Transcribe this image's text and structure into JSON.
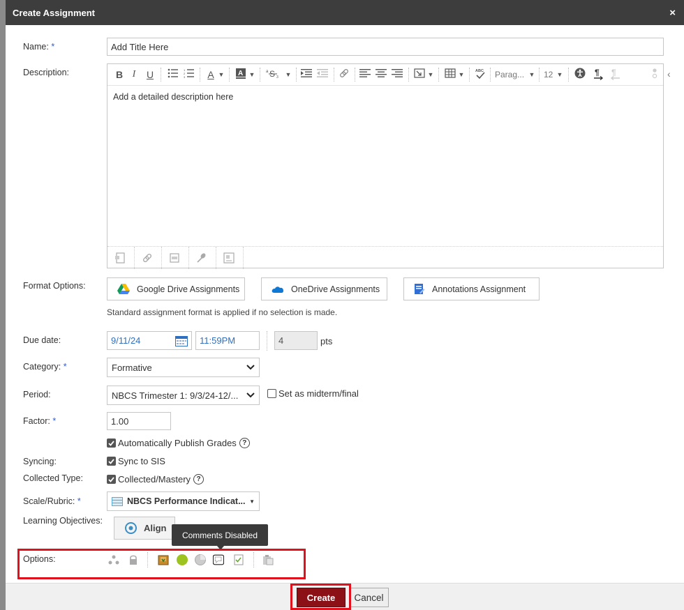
{
  "dialog": {
    "title": "Create Assignment",
    "close_glyph": "×"
  },
  "name": {
    "label": "Name:",
    "required_mark": "*",
    "value": "Add Title Here"
  },
  "description": {
    "label": "Description:",
    "placeholder": "Add a detailed description here",
    "toolbar": {
      "bold": "B",
      "italic": "I",
      "underline": "U",
      "paragraph_format": "Parag...",
      "font_size": "12",
      "spell_check": "ABC",
      "font_color": "A",
      "highlight": "A"
    }
  },
  "format_options": {
    "label": "Format Options:",
    "buttons": [
      {
        "label": "Google Drive Assignments",
        "icon": "google-drive-icon"
      },
      {
        "label": "OneDrive Assignments",
        "icon": "onedrive-icon"
      },
      {
        "label": "Annotations Assignment",
        "icon": "annotations-icon"
      }
    ],
    "note": "Standard assignment format is applied if no selection is made."
  },
  "due_date": {
    "label": "Due date:",
    "date": "9/11/24",
    "time": "11:59PM",
    "points": "4",
    "points_unit": "pts"
  },
  "category": {
    "label": "Category:",
    "required_mark": "*",
    "value": "Formative"
  },
  "period": {
    "label": "Period:",
    "value": "NBCS Trimester 1: 9/3/24-12/...",
    "midterm_label": "Set as midterm/final"
  },
  "factor": {
    "label": "Factor:",
    "required_mark": "*",
    "value": "1.00"
  },
  "publish": {
    "label": "Automatically Publish Grades",
    "help": "?"
  },
  "syncing": {
    "label": "Syncing:",
    "option": "Sync to SIS"
  },
  "collected": {
    "label": "Collected Type:",
    "option": "Collected/Mastery",
    "help": "?"
  },
  "scale": {
    "label": "Scale/Rubric:",
    "required_mark": "*",
    "value": "NBCS Performance Indicat..."
  },
  "objectives": {
    "label": "Learning Objectives:",
    "align_label": "Align"
  },
  "options": {
    "label": "Options:",
    "tooltip": "Comments Disabled"
  },
  "footer": {
    "create_label": "Create",
    "cancel_label": "Cancel"
  },
  "colors": {
    "accent": "#8b1117",
    "highlight_box": "#e0101d",
    "link_text": "#2f6fbf",
    "green_dot": "#9cc31f"
  }
}
